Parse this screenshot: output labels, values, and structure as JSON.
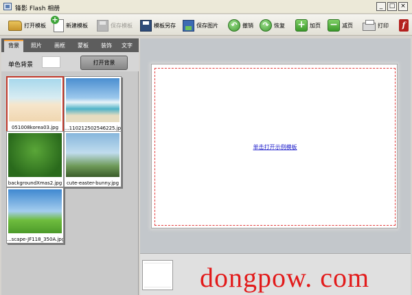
{
  "window": {
    "title": "锋影 Flash 相册",
    "minimize": "_",
    "maximize": "□",
    "close": "×"
  },
  "toolbar": {
    "open_template": "打开模板",
    "new_template": "新建模板",
    "save_template": "保存模板",
    "template_save_as": "模板另存",
    "save_image": "保存图片",
    "undo": "撤销",
    "redo": "恢复",
    "add_page": "加页",
    "remove_page": "减页",
    "print": "打印",
    "flash_icon_glyph": "f"
  },
  "tabs": [
    "背景",
    "照片",
    "画框",
    "蒙板",
    "装饰",
    "文字"
  ],
  "background_panel": {
    "solid_label": "单色背景",
    "open_button": "打开背景"
  },
  "thumbnails": [
    {
      "name": "051008korea03.jpg"
    },
    {
      "name": "...110212502546225.jpg"
    },
    {
      "name": "backgroundXmas2.jpg"
    },
    {
      "name": "cute-easter-bunny.jpg"
    },
    {
      "name": "...scape-JF118_350A.jpg"
    }
  ],
  "canvas": {
    "link_text": "单击打开示例模板"
  },
  "watermark": "dongpow. com"
}
